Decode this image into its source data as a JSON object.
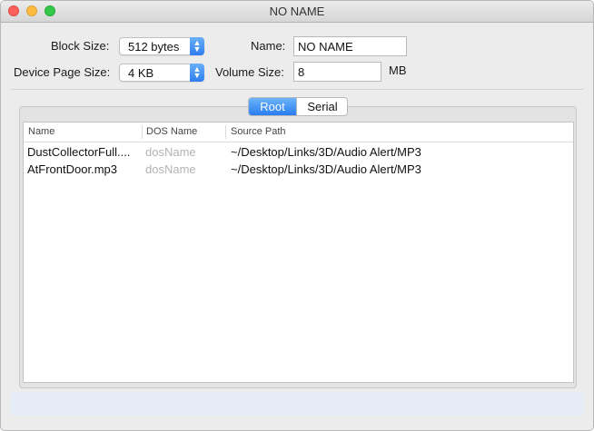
{
  "window": {
    "title": "NO NAME"
  },
  "settings": {
    "block_size_label": "Block Size:",
    "block_size_value": "512 bytes",
    "device_page_size_label": "Device Page Size:",
    "device_page_size_value": "4 KB",
    "name_label": "Name:",
    "name_value": "NO NAME",
    "volume_size_label": "Volume Size:",
    "volume_size_value": "8",
    "volume_size_unit": "MB"
  },
  "tabs": [
    {
      "label": "Root",
      "selected": true
    },
    {
      "label": "Serial",
      "selected": false
    }
  ],
  "table": {
    "columns": [
      "Name",
      "DOS Name",
      "Source Path"
    ],
    "rows": [
      {
        "name": "DustCollectorFull....",
        "dos_name": "dosName",
        "source_path": "~/Desktop/Links/3D/Audio Alert/MP3"
      },
      {
        "name": "AtFrontDoor.mp3",
        "dos_name": "dosName",
        "source_path": "~/Desktop/Links/3D/Audio Alert/MP3"
      }
    ]
  },
  "colors": {
    "accent": "#2f7ef0",
    "window_bg": "#ececec",
    "placeholder": "#b3b3b3"
  }
}
